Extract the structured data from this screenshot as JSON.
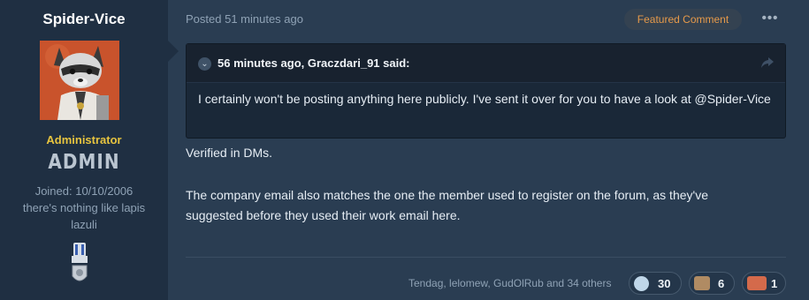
{
  "author": {
    "username": "Spider-Vice",
    "role_title": "Administrator",
    "role_banner": "ADMIN",
    "joined": "Joined: 10/10/2006",
    "custom_title": "there's nothing like lapis lazuli"
  },
  "post": {
    "posted_text": "Posted 51 minutes ago",
    "featured_label": "Featured Comment",
    "more_menu": "•••",
    "quote": {
      "attribution": "56 minutes ago, Graczdari_91 said:",
      "text": "I certainly won't be posting anything here publicly. I've sent it over for you to have a look at @Spider-Vice"
    },
    "message_line1": "Verified in DMs.",
    "message_line2": "The company email also matches the one the member used to register on the forum, as they've suggested before they used their work email here."
  },
  "reactions": {
    "reactors_text": "Tendag, lelomew, GudOlRub and 34 others",
    "items": [
      {
        "icon": "thanks-reaction-icon",
        "count": "30"
      },
      {
        "icon": "image-reaction-icon",
        "count": "6"
      },
      {
        "icon": "image-reaction-icon-2",
        "count": "1"
      }
    ]
  },
  "colors": {
    "background": "#2a3d52",
    "author_panel": "#1f2f42",
    "featured_text": "#e79a4a",
    "role_title": "#e7c43f"
  }
}
